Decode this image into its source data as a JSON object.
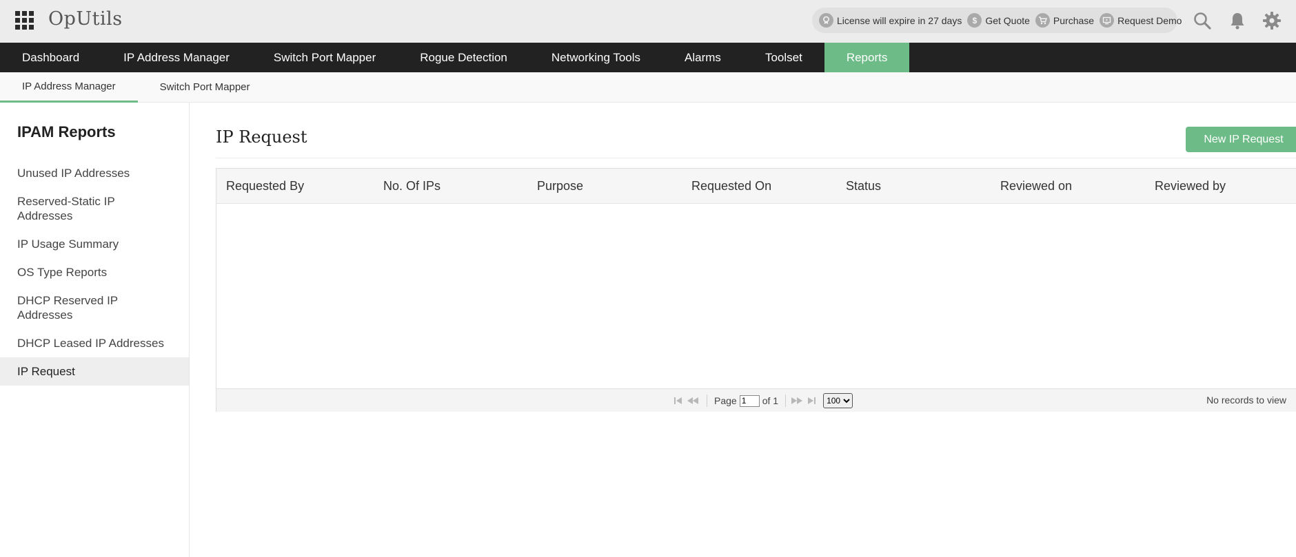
{
  "app": {
    "logo": "OpUtils"
  },
  "header": {
    "license_text": "License will expire in 27 days",
    "get_quote": "Get Quote",
    "purchase": "Purchase",
    "request_demo": "Request Demo"
  },
  "main_nav": [
    {
      "label": "Dashboard"
    },
    {
      "label": "IP Address Manager"
    },
    {
      "label": "Switch Port Mapper"
    },
    {
      "label": "Rogue Detection"
    },
    {
      "label": "Networking Tools"
    },
    {
      "label": "Alarms"
    },
    {
      "label": "Toolset"
    },
    {
      "label": "Reports",
      "active": true
    }
  ],
  "sub_nav": [
    {
      "label": "IP Address Manager",
      "active": true
    },
    {
      "label": "Switch Port Mapper"
    }
  ],
  "sidebar": {
    "title": "IPAM Reports",
    "items": [
      {
        "label": "Unused IP Addresses"
      },
      {
        "label": "Reserved-Static IP Addresses"
      },
      {
        "label": "IP Usage Summary"
      },
      {
        "label": "OS Type Reports"
      },
      {
        "label": "DHCP Reserved IP Addresses"
      },
      {
        "label": "DHCP Leased IP Addresses"
      },
      {
        "label": "IP Request",
        "active": true
      }
    ]
  },
  "main": {
    "title": "IP Request",
    "new_button": "New IP Request",
    "columns": [
      "Requested By",
      "No. Of IPs",
      "Purpose",
      "Requested On",
      "Status",
      "Reviewed on",
      "Reviewed by"
    ],
    "pager": {
      "page_label": "Page",
      "page_value": "1",
      "of_label": "of 1",
      "page_size": "100"
    },
    "empty_text": "No records to view"
  },
  "colors": {
    "accent": "#6dbb86",
    "nav_bg": "#222222",
    "header_bg": "#ececec"
  }
}
